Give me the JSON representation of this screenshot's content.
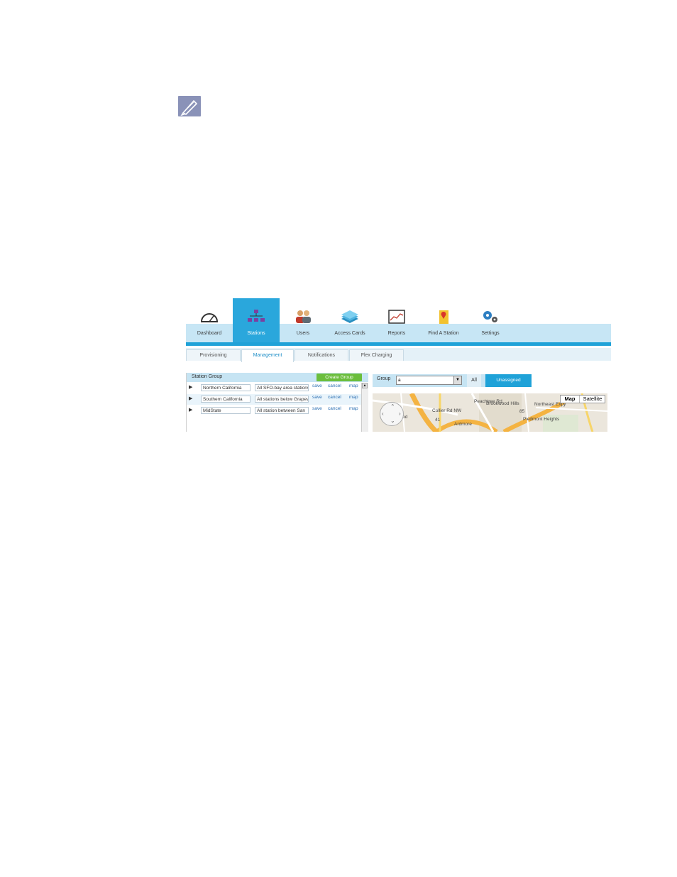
{
  "note_icon": "pen-nib-icon",
  "nav": {
    "items": [
      {
        "label": "Dashboard",
        "icon": "gauge-icon"
      },
      {
        "label": "Stations",
        "icon": "org-chart-icon",
        "active": true
      },
      {
        "label": "Users",
        "icon": "users-icon"
      },
      {
        "label": "Access Cards",
        "icon": "cards-icon"
      },
      {
        "label": "Reports",
        "icon": "chart-icon"
      },
      {
        "label": "Find A Station",
        "icon": "map-pin-icon"
      },
      {
        "label": "Settings",
        "icon": "gears-icon"
      }
    ]
  },
  "subtabs": [
    "Provisioning",
    "Management",
    "Notifications",
    "Flex Charging"
  ],
  "active_subtab": "Management",
  "station_group": {
    "title": "Station Group",
    "create_label": "Create Group",
    "rows": [
      {
        "name": "Northern California",
        "desc": "All SFO-bay area stations",
        "save": "save",
        "cancel": "cancel",
        "map": "map"
      },
      {
        "name": "Southern California",
        "desc": "All stations below Grapevine",
        "save": "save",
        "cancel": "cancel",
        "map": "map"
      },
      {
        "name": "MidState",
        "desc": "All station between San",
        "save": "save",
        "cancel": "cancel",
        "map": "map"
      }
    ]
  },
  "group_filter": {
    "label": "Group",
    "value": "a",
    "all_label": "All",
    "unassigned_label": "Unassigned"
  },
  "map": {
    "map_label": "Map",
    "satellite_label": "Satellite",
    "places": [
      "Brookwood Hills",
      "Piedmont Heights",
      "Ardmore",
      "Collier Rd NW",
      "Peachtree Rd",
      "Northeast Expy",
      "41",
      "85",
      "od"
    ]
  },
  "colors": {
    "accent": "#1fa2d8",
    "create": "#6bbe3c",
    "link": "#2b6fb3"
  }
}
